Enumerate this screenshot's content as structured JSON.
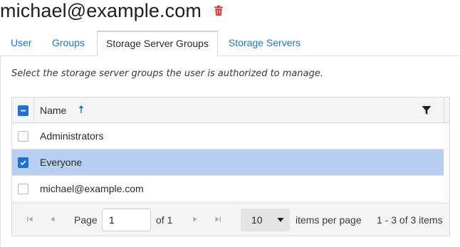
{
  "header": {
    "title": "michael@example.com",
    "delete_icon": "trash-icon",
    "delete_color": "#e0322f"
  },
  "tabs": [
    {
      "label": "User",
      "active": false
    },
    {
      "label": "Groups",
      "active": false
    },
    {
      "label": "Storage Server Groups",
      "active": true
    },
    {
      "label": "Storage Servers",
      "active": false
    }
  ],
  "panel": {
    "description": "Select the storage server groups the user is authorized to manage."
  },
  "grid": {
    "columns": [
      {
        "label": "Name",
        "sort": "ascending"
      }
    ],
    "header_checkbox": "partial",
    "rows": [
      {
        "name": "Administrators",
        "checked": false
      },
      {
        "name": "Everyone",
        "checked": true
      },
      {
        "name": "michael@example.com",
        "checked": false
      }
    ],
    "selected_row_color": "#b7cff2",
    "accent_color": "#1e6fd9"
  },
  "pager": {
    "page_label": "Page",
    "page_value": "1",
    "of_label": "of 1",
    "page_size": "10",
    "items_per_page_label": "items per page",
    "range_label": "1 - 3 of 3 items"
  }
}
